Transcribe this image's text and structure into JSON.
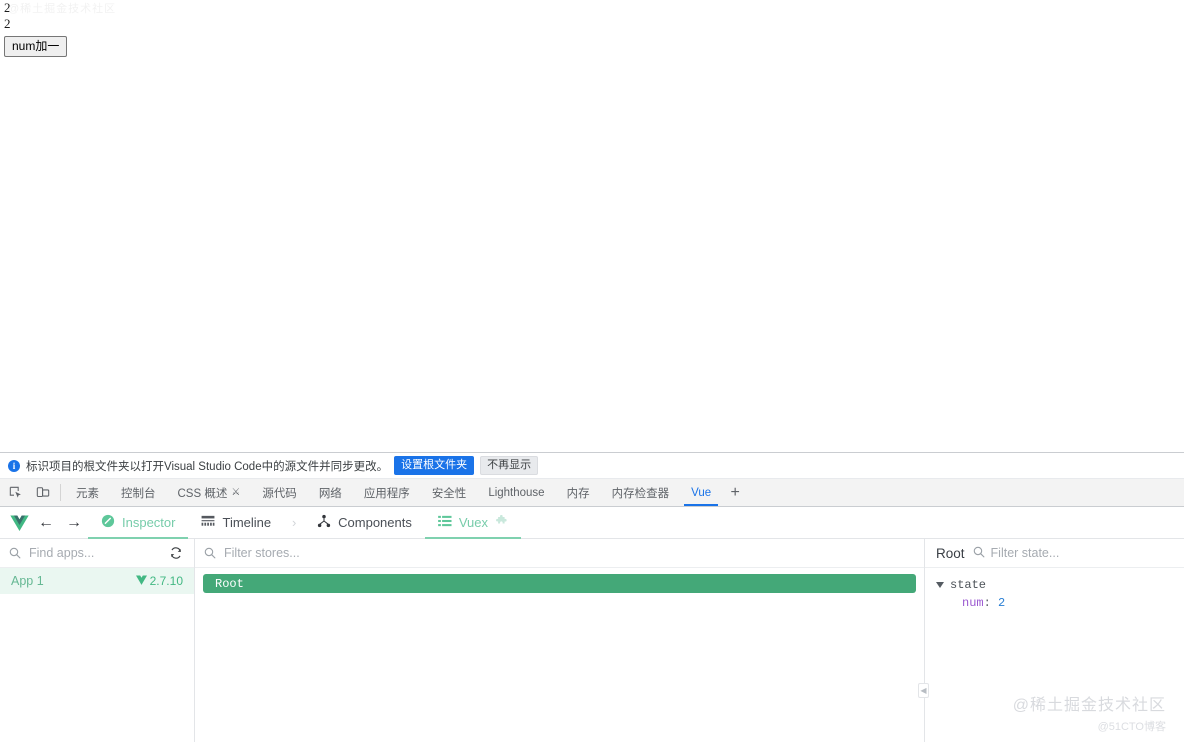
{
  "page": {
    "watermark_top": "@稀土掘金技术社区",
    "lines": [
      "2",
      "2"
    ],
    "button_label": "num加一"
  },
  "notice": {
    "icon": "info-icon",
    "text": "标识项目的根文件夹以打开Visual Studio Code中的源文件并同步更改。",
    "primary_label": "设置根文件夹",
    "secondary_label": "不再显示"
  },
  "devtools": {
    "icons": [
      {
        "name": "inspect-element-icon"
      },
      {
        "name": "device-toolbar-icon"
      }
    ],
    "tabs": [
      {
        "label": "元素",
        "active": false,
        "badge": ""
      },
      {
        "label": "控制台",
        "active": false,
        "badge": ""
      },
      {
        "label": "CSS 概述",
        "active": false,
        "badge": "flask-icon"
      },
      {
        "label": "源代码",
        "active": false,
        "badge": ""
      },
      {
        "label": "网络",
        "active": false,
        "badge": ""
      },
      {
        "label": "应用程序",
        "active": false,
        "badge": ""
      },
      {
        "label": "安全性",
        "active": false,
        "badge": ""
      },
      {
        "label": "Lighthouse",
        "active": false,
        "badge": ""
      },
      {
        "label": "内存",
        "active": false,
        "badge": ""
      },
      {
        "label": "内存检查器",
        "active": false,
        "badge": ""
      },
      {
        "label": "Vue",
        "active": true,
        "badge": ""
      }
    ],
    "add_tab_label": "+"
  },
  "vue": {
    "logo_name": "vue-logo-icon",
    "back_label": "←",
    "forward_label": "→",
    "tabs": [
      {
        "label": "Inspector",
        "icon": "inspector-icon",
        "active": true
      },
      {
        "label": "Timeline",
        "icon": "timeline-icon",
        "active": false
      },
      {
        "label": "Components",
        "icon": "components-icon",
        "active": false
      },
      {
        "label": "Vuex",
        "icon": "vuex-list-icon",
        "active": true,
        "extra_icon": "puzzle-icon"
      }
    ],
    "apps_pane": {
      "search_placeholder": "Find apps...",
      "refresh_icon": "refresh-icon",
      "items": [
        {
          "name": "App 1",
          "version": "2.7.10",
          "selected": true
        }
      ]
    },
    "stores_pane": {
      "search_placeholder": "Filter stores...",
      "stores": [
        {
          "label": "Root",
          "selected": true
        }
      ],
      "collapse_handle_icon": "chevron-left-icon"
    },
    "state_pane": {
      "title": "Root",
      "filter_placeholder": "Filter state...",
      "groups": [
        {
          "name": "state",
          "expanded": true,
          "entries": [
            {
              "key": "num",
              "value": "2"
            }
          ]
        }
      ]
    }
  },
  "watermarks": {
    "main": "@稀土掘金技术社区",
    "sub": "@51CTO博客"
  },
  "colors": {
    "vue_green": "#42b883",
    "store_green": "#44a878",
    "devtools_blue": "#1a73e8",
    "key_purple": "#9b59d0",
    "value_blue": "#2a7fd4"
  }
}
